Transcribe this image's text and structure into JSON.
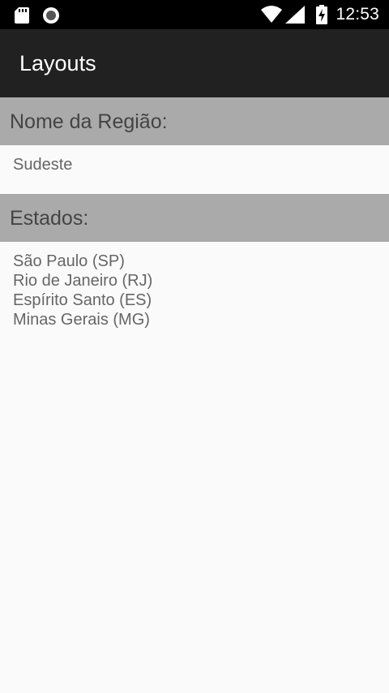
{
  "status_bar": {
    "icons_left": [
      "sd-card-icon",
      "record-icon"
    ],
    "icons_right": [
      "wifi-icon",
      "cell-signal-icon",
      "battery-charging-icon"
    ],
    "time": "12:53"
  },
  "app_bar": {
    "title": "Layouts",
    "background": "#212121"
  },
  "region": {
    "header": "Nome da Região:",
    "value": "Sudeste"
  },
  "states": {
    "header": "Estados:",
    "items": [
      "São Paulo (SP)",
      "Rio de Janeiro (RJ)",
      "Espírito Santo (ES)",
      "Minas Gerais (MG)"
    ]
  },
  "colors": {
    "section_header_bg": "#aaaaaa",
    "page_bg": "#fafafa"
  }
}
